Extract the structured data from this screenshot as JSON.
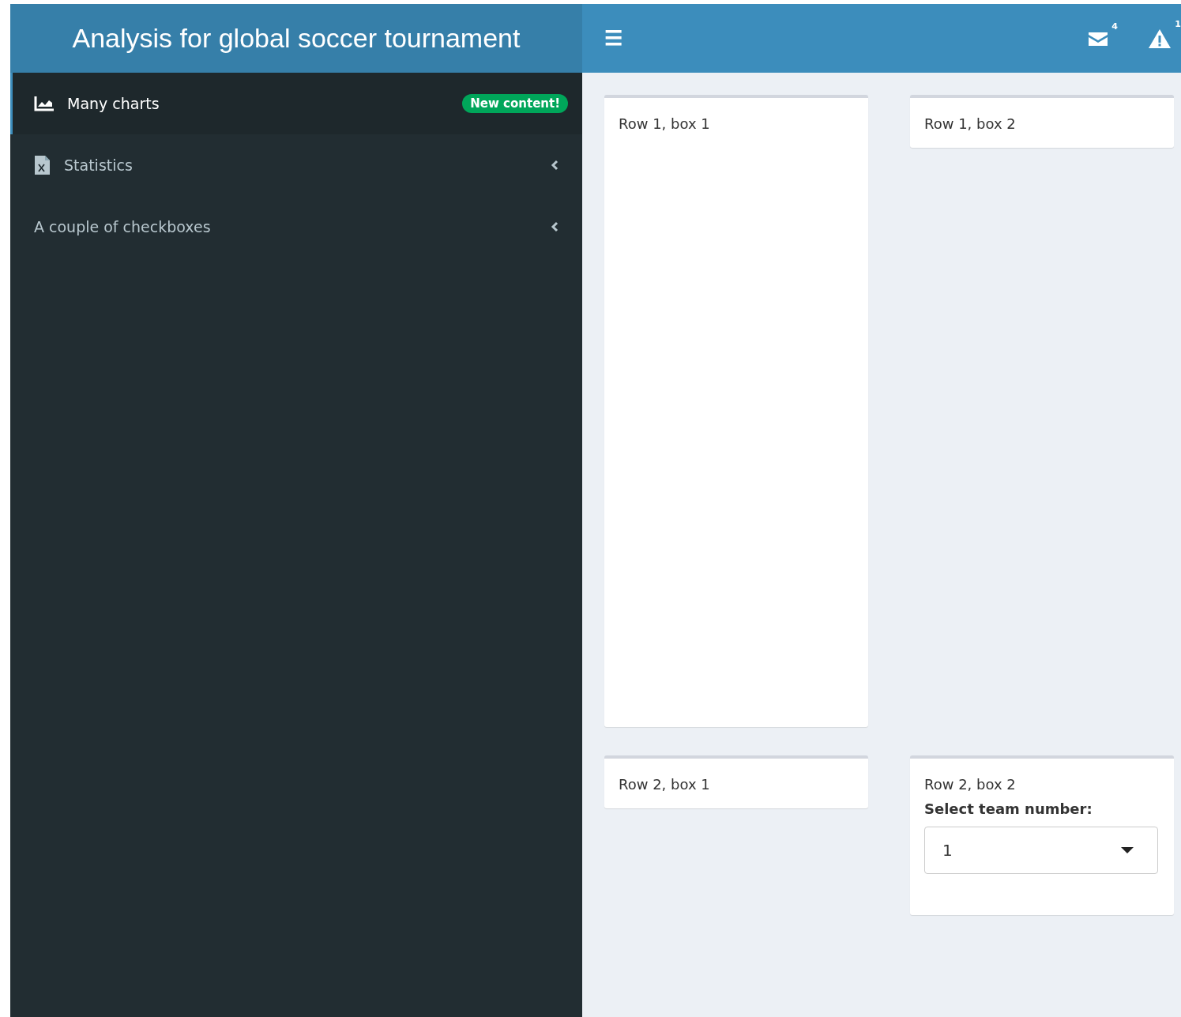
{
  "header": {
    "title": "Analysis for global soccer tournament",
    "menu_icon": "☰"
  },
  "notifications": [
    {
      "kind": "messages",
      "count": "4"
    },
    {
      "kind": "warnings",
      "count": "1"
    }
  ],
  "sidebar": {
    "items": [
      {
        "label": "Many charts",
        "kind": "chart",
        "selected": true,
        "badge": "New content!",
        "expandable": false
      },
      {
        "label": "Statistics",
        "kind": "file",
        "selected": false,
        "expandable": true
      },
      {
        "label": "A couple of checkboxes",
        "kind": "plain",
        "selected": false,
        "expandable": true
      }
    ]
  },
  "rows": [
    {
      "boxes": [
        {
          "text": "Row 1, box 1",
          "tall": true
        },
        {
          "text": "Row 1, box 2",
          "tall": false
        }
      ]
    },
    {
      "boxes": [
        {
          "text": "Row 2, box 1",
          "tall": false
        },
        {
          "text": "Row 2, box 2",
          "tall": false,
          "select": {
            "label": "Select team number:",
            "value": "1"
          }
        }
      ]
    }
  ]
}
